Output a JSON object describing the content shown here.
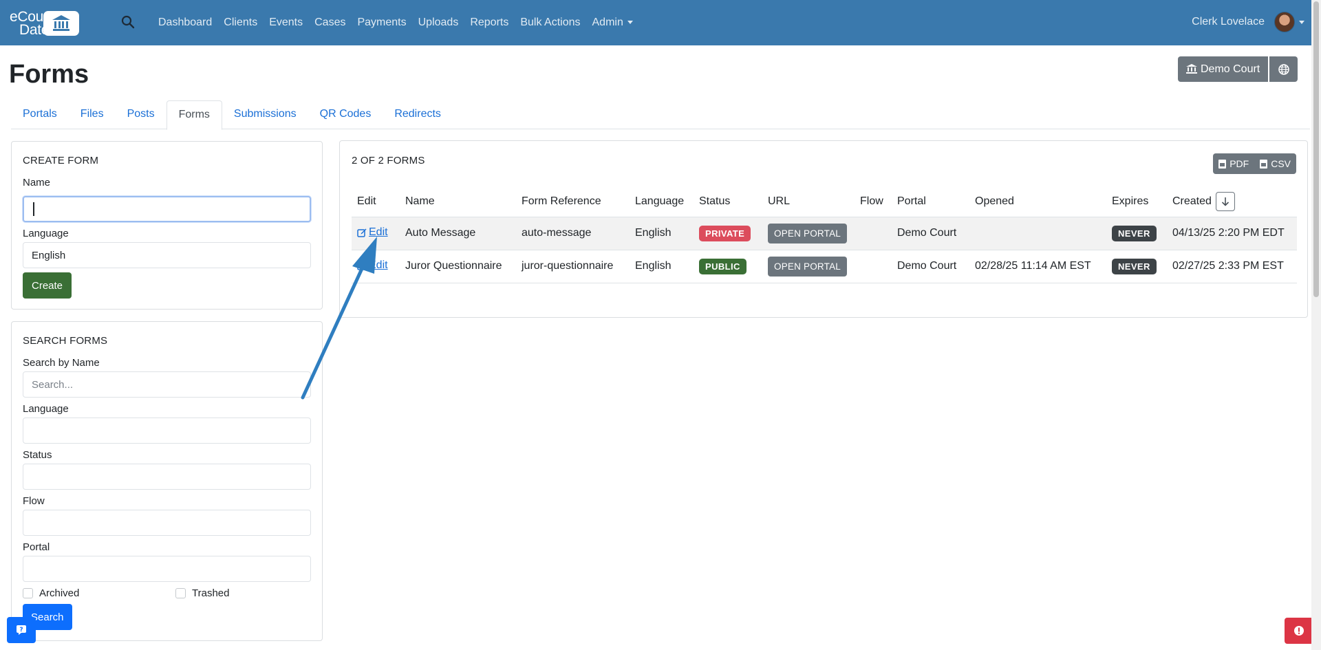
{
  "navbar": {
    "logo_line1": "eCourt",
    "logo_line2": "Date",
    "links": [
      "Dashboard",
      "Clients",
      "Events",
      "Cases",
      "Payments",
      "Uploads",
      "Reports",
      "Bulk Actions",
      "Admin"
    ],
    "user_name": "Clerk Lovelace",
    "bg_color": "#3a79ad"
  },
  "page": {
    "title": "Forms",
    "court_button": "Demo Court"
  },
  "tabs": [
    "Portals",
    "Files",
    "Posts",
    "Forms",
    "Submissions",
    "QR Codes",
    "Redirects"
  ],
  "active_tab": "Forms",
  "create_form": {
    "heading": "CREATE FORM",
    "name_label": "Name",
    "name_value": "",
    "language_label": "Language",
    "language_value": "English",
    "create_button": "Create"
  },
  "search_forms": {
    "heading": "SEARCH FORMS",
    "name_label": "Search by Name",
    "name_placeholder": "Search...",
    "language_label": "Language",
    "status_label": "Status",
    "flow_label": "Flow",
    "portal_label": "Portal",
    "archived_label": "Archived",
    "trashed_label": "Trashed",
    "search_button": "Search"
  },
  "table": {
    "count_label": "2 OF 2 FORMS",
    "export_pdf": "PDF",
    "export_csv": "CSV",
    "columns": [
      "Edit",
      "Name",
      "Form Reference",
      "Language",
      "Status",
      "URL",
      "Flow",
      "Portal",
      "Opened",
      "Expires",
      "Created"
    ],
    "rows": [
      {
        "edit": "Edit",
        "name": "Auto Message",
        "reference": "auto-message",
        "language": "English",
        "status": "PRIVATE",
        "url": "OPEN PORTAL",
        "flow": "",
        "portal": "Demo Court",
        "opened": "",
        "expires": "NEVER",
        "created": "04/13/25 2:20 PM EDT"
      },
      {
        "edit": "Edit",
        "name": "Juror Questionnaire",
        "reference": "juror-questionnaire",
        "language": "English",
        "status": "PUBLIC",
        "url": "OPEN PORTAL",
        "flow": "",
        "portal": "Demo Court",
        "opened": "02/28/25 11:14 AM EST",
        "expires": "NEVER",
        "created": "02/27/25 2:33 PM EST"
      }
    ]
  },
  "colors": {
    "primary": "#0d6efd",
    "success": "#3a6f35",
    "danger": "#dc4c5c",
    "secondary": "#6c757d",
    "annotation_arrow": "#2f7ec0"
  },
  "icons": [
    "search-icon",
    "bank-icon",
    "globe-icon",
    "pdf-icon",
    "csv-icon",
    "edit-icon",
    "arrow-down-icon",
    "help-icon",
    "alert-icon"
  ]
}
